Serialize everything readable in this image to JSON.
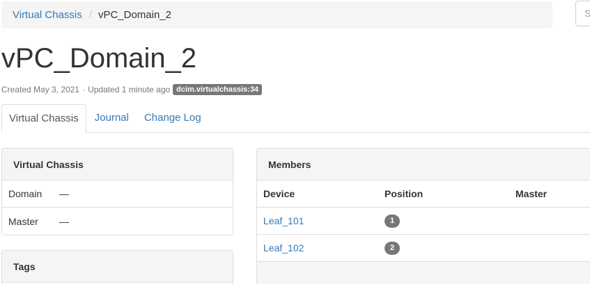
{
  "breadcrumb": {
    "parent_label": "Virtual Chassis",
    "separator": "/",
    "current_label": "vPC_Domain_2"
  },
  "search": {
    "placeholder_visible": "S"
  },
  "page": {
    "title": "vPC_Domain_2",
    "created": "Created May 3, 2021",
    "dot": "·",
    "updated": "Updated 1 minute ago",
    "object_id": "dcim.virtualchassis:34"
  },
  "tabs": [
    {
      "label": "Virtual Chassis",
      "active": true
    },
    {
      "label": "Journal",
      "active": false
    },
    {
      "label": "Change Log",
      "active": false
    }
  ],
  "virtual_chassis_panel": {
    "heading": "Virtual Chassis",
    "rows": [
      {
        "key": "Domain",
        "value": "—"
      },
      {
        "key": "Master",
        "value": "—"
      }
    ]
  },
  "tags_panel": {
    "heading": "Tags"
  },
  "members_panel": {
    "heading": "Members",
    "columns": [
      "Device",
      "Position",
      "Master"
    ],
    "rows": [
      {
        "device": "Leaf_101",
        "position": "1",
        "master": ""
      },
      {
        "device": "Leaf_102",
        "position": "2",
        "master": ""
      }
    ]
  },
  "colors": {
    "link": "#337ab7",
    "badge": "#777777",
    "panel_heading_bg": "#f5f5f5",
    "border": "#dddddd"
  }
}
